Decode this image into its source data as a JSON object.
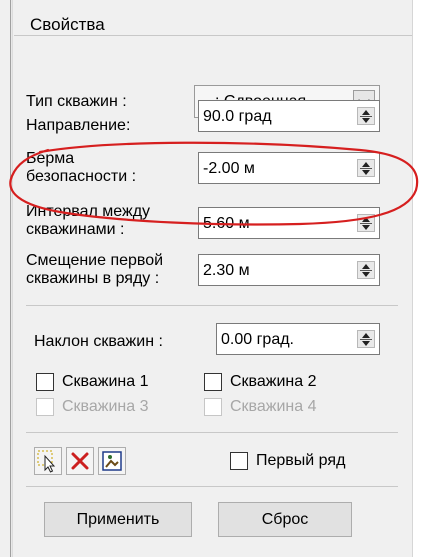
{
  "panel": {
    "title": "Свойства"
  },
  "well_type": {
    "label": "Тип скважин :",
    "value": ": Сдвоенная"
  },
  "direction": {
    "label": "Направление:",
    "value": "90.0 град"
  },
  "safety_berm": {
    "label_line1": "Берма",
    "label_line2": "безопасности :",
    "value": "-2.00 м"
  },
  "well_interval": {
    "label_line1": "Интервал между",
    "label_line2": "скважинами :",
    "value": "5.60 м"
  },
  "first_well_offset": {
    "label_line1": "Смещение первой",
    "label_line2": "скважины в ряду :",
    "value": "2.30 м"
  },
  "well_incline": {
    "label": "Наклон скважин :",
    "value": "0.00 град."
  },
  "checkboxes": [
    {
      "label": "Скважина 1",
      "checked": false,
      "enabled": true
    },
    {
      "label": "Скважина 2",
      "checked": false,
      "enabled": true
    },
    {
      "label": "Скважина 3",
      "checked": false,
      "enabled": false
    },
    {
      "label": "Скважина 4",
      "checked": false,
      "enabled": false
    }
  ],
  "first_row": {
    "label": "Первый ряд",
    "checked": false
  },
  "buttons": {
    "apply": "Применить",
    "reset": "Сброс"
  },
  "toolbar_icons": [
    "select-pointer-icon",
    "delete-x-icon",
    "settings-image-icon"
  ],
  "colors": {
    "annotation": "#d61f1f",
    "delete_icon": "#cc1f1f"
  }
}
